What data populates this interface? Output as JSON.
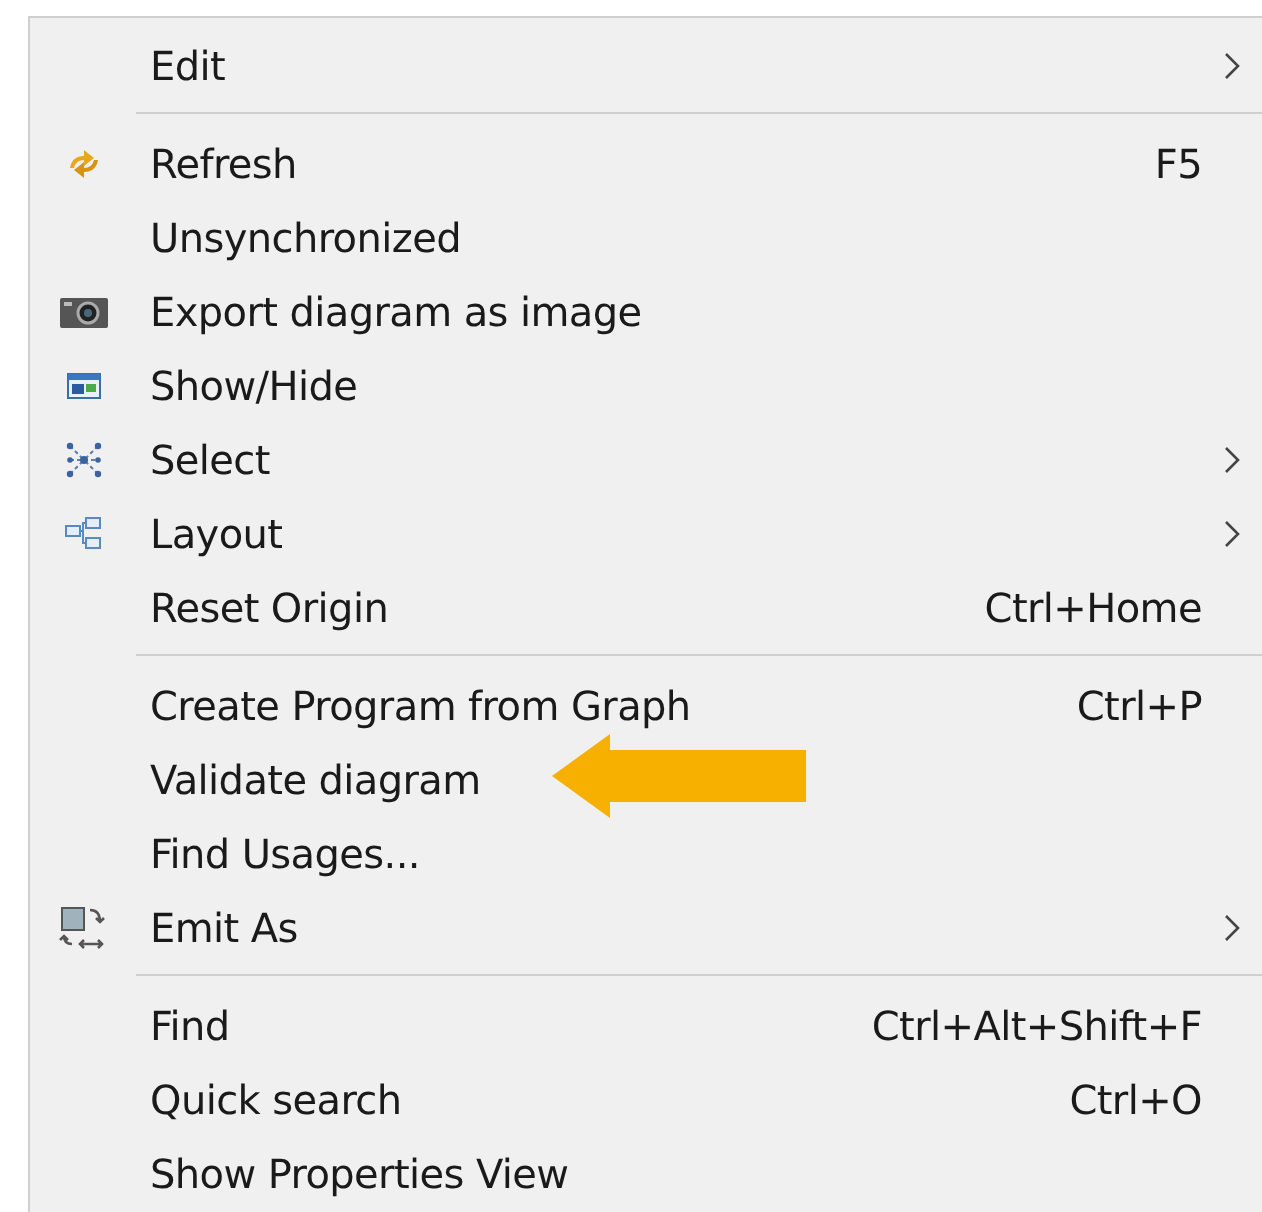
{
  "menu": {
    "sections": [
      {
        "items": [
          {
            "label": "Edit",
            "submenu": true
          }
        ]
      },
      {
        "items": [
          {
            "label": "Refresh",
            "kind": "refresh",
            "shortcut": "F5"
          },
          {
            "label": "Unsynchronized"
          },
          {
            "label": "Export diagram as image",
            "kind": "camera"
          },
          {
            "label": "Show/Hide",
            "kind": "window"
          },
          {
            "label": "Select",
            "kind": "graph",
            "submenu": true
          },
          {
            "label": "Layout",
            "kind": "layout",
            "submenu": true
          },
          {
            "label": "Reset Origin",
            "shortcut": "Ctrl+Home"
          }
        ]
      },
      {
        "items": [
          {
            "label": "Create Program from Graph",
            "shortcut": "Ctrl+P"
          },
          {
            "label": "Validate diagram"
          },
          {
            "label": "Find Usages..."
          },
          {
            "label": "Emit As",
            "kind": "emit",
            "submenu": true
          }
        ]
      },
      {
        "items": [
          {
            "label": "Find",
            "shortcut": "Ctrl+Alt+Shift+F"
          },
          {
            "label": "Quick search",
            "shortcut": "Ctrl+O"
          },
          {
            "label": "Show Properties View"
          }
        ]
      }
    ]
  }
}
